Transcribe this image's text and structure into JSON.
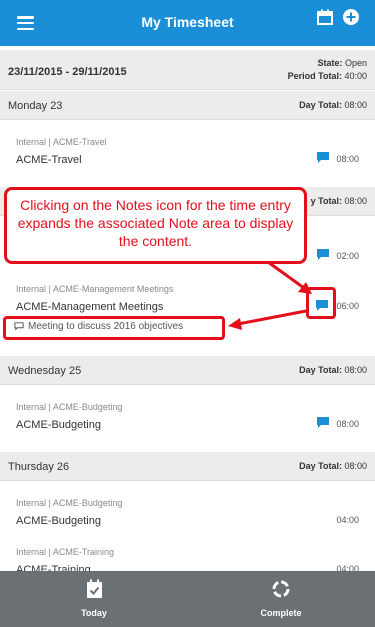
{
  "header": {
    "title": "My Timesheet"
  },
  "period": {
    "range": "23/11/2015 - 29/11/2015",
    "state_label": "State:",
    "state_value": "Open",
    "total_label": "Period Total:",
    "total_value": "40:00"
  },
  "days": [
    {
      "name": "Monday 23",
      "total_label": "Day Total:",
      "total_value": "08:00"
    },
    {
      "total_fragment_label": "y Total:",
      "total_value": "08:00"
    },
    {
      "name": "Wednesday 25",
      "total_label": "Day Total:",
      "total_value": "08:00"
    },
    {
      "name": "Thursday 26",
      "total_label": "Day Total:",
      "total_value": "08:00"
    }
  ],
  "entries": [
    {
      "category": "Internal | ACME-Travel",
      "name": "ACME-Travel",
      "hours": "08:00",
      "has_note": true
    },
    {
      "hours": "02:00",
      "has_note": true
    },
    {
      "category": "Internal | ACME-Management Meetings",
      "name": "ACME-Management Meetings",
      "hours": "06:00",
      "has_note": true,
      "note": "Meeting to discuss 2016 objectives"
    },
    {
      "category": "Internal | ACME-Budgeting",
      "name": "ACME-Budgeting",
      "hours": "08:00",
      "has_note": true
    },
    {
      "category": "Internal | ACME-Budgeting",
      "name": "ACME-Budgeting",
      "hours": "04:00",
      "has_note": false
    },
    {
      "category": "Internal | ACME-Training",
      "name": "ACME-Training",
      "hours": "04:00",
      "has_note": false
    }
  ],
  "callout": {
    "text": "Clicking on the Notes icon for the time entry expands the associated Note area to display the content."
  },
  "tabs": [
    {
      "label": "Today"
    },
    {
      "label": "Complete"
    }
  ],
  "colors": {
    "accent": "#1a8fd8",
    "annotation": "#e3101b",
    "bottom_bar": "#6b7075"
  }
}
